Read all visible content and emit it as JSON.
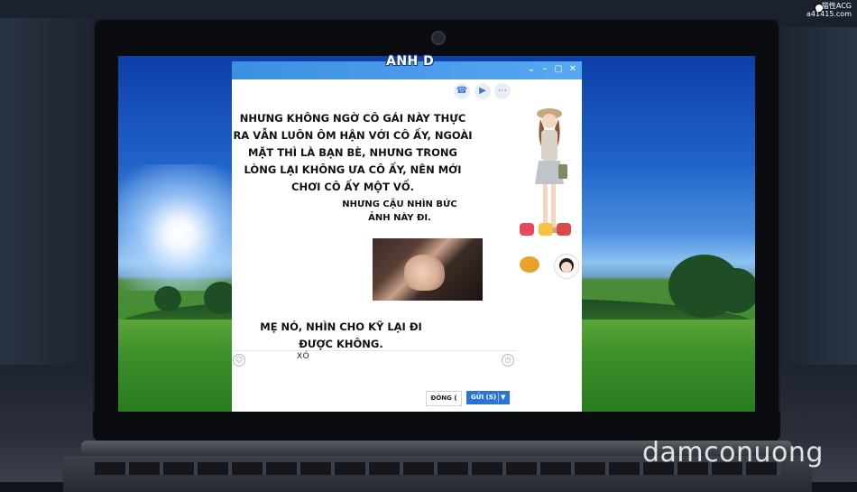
{
  "chat": {
    "title": "ANH D",
    "window_controls": [
      "⌄",
      "–",
      "▢",
      "✕"
    ],
    "messages": [
      {
        "text": "NHƯNG KHÔNG NGỜ CÔ GÁI NÀY THỰC RA VẪN LUÔN ÔM HẬN VỚI CÔ ẤY, NGOÀI MẶT THÌ LÀ BẠN BÈ, NHƯNG TRONG LÒNG LẠI KHÔNG ƯA CÔ ẤY, NÊN MỚI CHƠI CÔ ẤY MỘT VỐ."
      },
      {
        "text": "NHƯNG CẬU NHÌN BỨC ẢNH NÀY ĐI."
      },
      {
        "text": "MẸ NÓ, NHÌN CHO KỸ LẠI ĐI ĐƯỢC KHÔNG."
      }
    ],
    "input_text": "XÓ",
    "close_button": "ĐÓNG (",
    "send_button": "GỬI (S)"
  },
  "watermarks": {
    "top_line1": "猫性ACG",
    "top_line2": "a41415.com",
    "bottom": "damconuong"
  },
  "colors": {
    "title_bar": "#3d8fe0",
    "send_button": "#2c74d3"
  },
  "icons": {
    "header": [
      "phone-icon",
      "video-icon",
      "more-icon"
    ],
    "input": [
      "emoji-icon",
      "clock-icon"
    ]
  }
}
